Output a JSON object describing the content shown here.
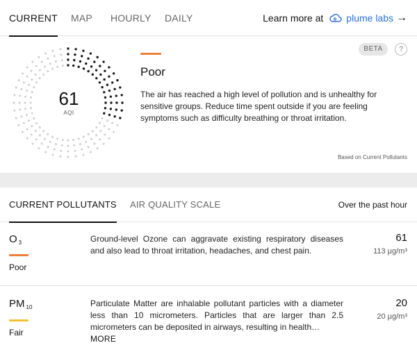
{
  "tabs": {
    "current": "CURRENT",
    "map": "MAP",
    "hourly": "HOURLY",
    "daily": "DAILY"
  },
  "learn_more": {
    "text": "Learn more at",
    "brand": "plume labs",
    "arrow": "→",
    "icon": "plume-cloud-icon"
  },
  "aqi": {
    "value": "61",
    "label": "AQI",
    "gauge_fraction": 0.3,
    "level": "Poor",
    "level_color": "#f07f3c",
    "description": "The air has reached a high level of pollution and is unhealthy for sensitive groups. Reduce time spent outside if you are feeling symptoms such as difficulty breathing or throat irritation.",
    "beta": "BETA",
    "help": "?",
    "based_on": "Based on Current Pollutants"
  },
  "pollutant_tabs": {
    "current": "CURRENT POLLUTANTS",
    "scale": "AIR QUALITY SCALE",
    "period": "Over the past hour"
  },
  "pollutants": [
    {
      "name": "O",
      "sub": "3",
      "level": "Poor",
      "color": "#f07f3c",
      "description": "Ground-level Ozone can aggravate existing respiratory diseases and also lead to throat irritation, headaches, and chest pain.",
      "value": "61",
      "unit": "113 μg/m³"
    },
    {
      "name": "PM",
      "sub": "10",
      "level": "Fair",
      "color": "#f2c230",
      "description": "Particulate Matter are inhalable pollutant particles with a diameter less than 10 micrometers. Particles that are larger than 2.5 micrometers can be deposited in airways, resulting in health…",
      "more": "MORE",
      "value": "20",
      "unit": "20 μg/m³"
    }
  ]
}
